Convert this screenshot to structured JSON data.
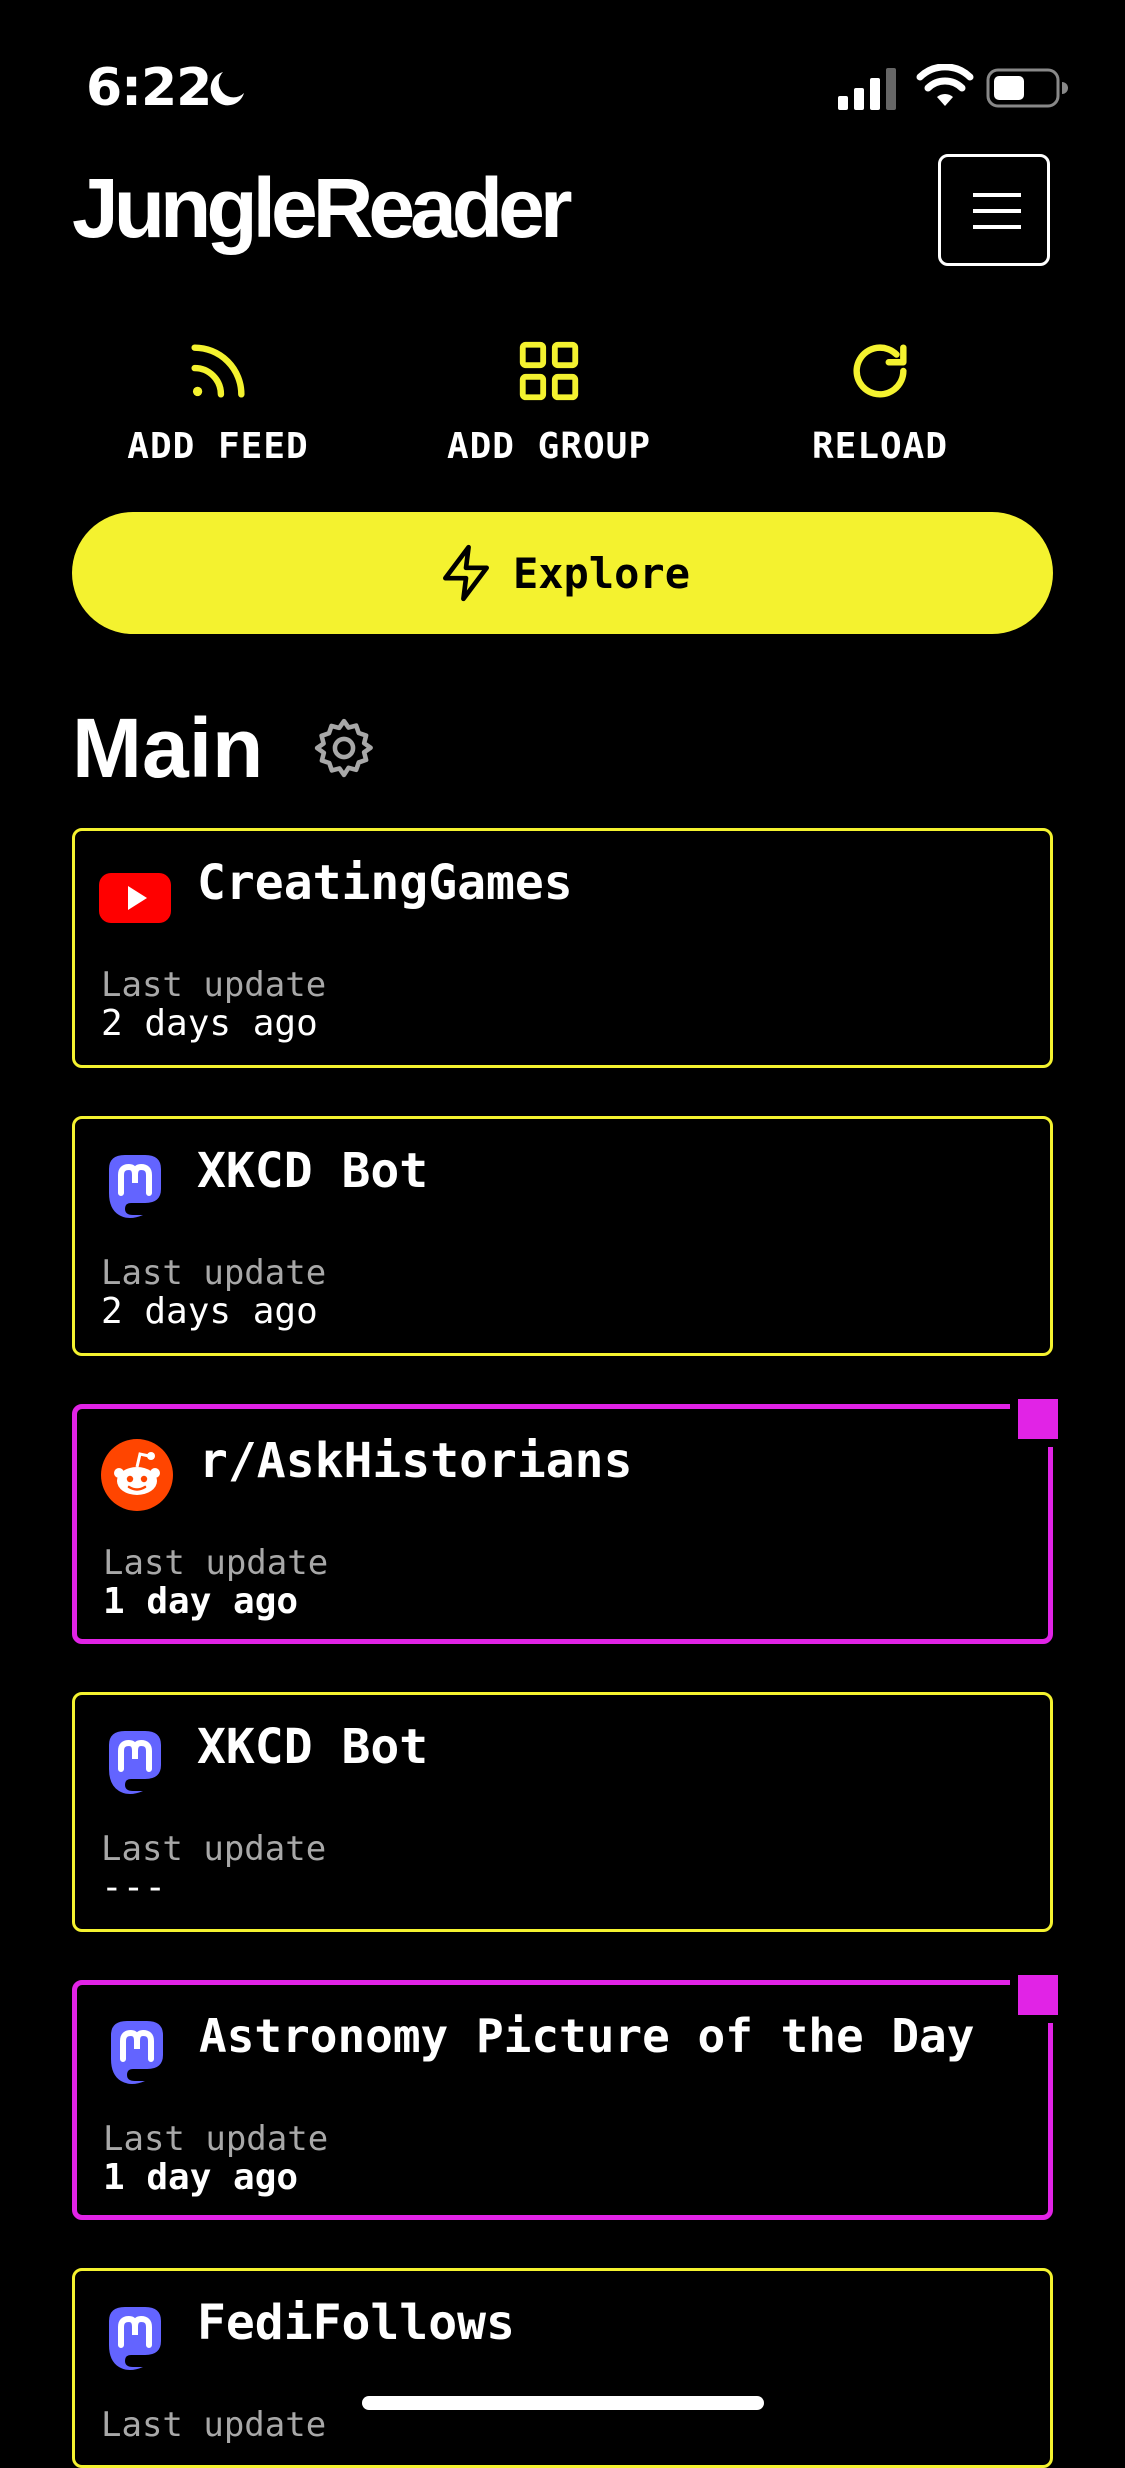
{
  "status": {
    "time": "6:22"
  },
  "header": {
    "brand": "JungleReader"
  },
  "actions": {
    "add_feed": "ADD FEED",
    "add_group": "ADD GROUP",
    "reload": "RELOAD"
  },
  "explore": {
    "label": "Explore"
  },
  "section": {
    "title": "Main"
  },
  "colors": {
    "accent": "#f4f22f",
    "unread": "#e123e6",
    "background": "#000000"
  },
  "feeds": [
    {
      "title": "CreatingGames",
      "icon": "youtube-icon",
      "meta_label": "Last update",
      "meta_value": "2 days ago",
      "unread": false
    },
    {
      "title": "XKCD Bot",
      "icon": "mastodon-icon",
      "meta_label": "Last update",
      "meta_value": "2 days ago",
      "unread": false
    },
    {
      "title": "r/AskHistorians",
      "icon": "reddit-icon",
      "meta_label": "Last update",
      "meta_value": "1 day ago",
      "unread": true
    },
    {
      "title": "XKCD Bot",
      "icon": "mastodon-icon",
      "meta_label": "Last update",
      "meta_value": "---",
      "unread": false
    },
    {
      "title": "Astronomy Picture of the Day",
      "icon": "mastodon-icon",
      "meta_label": "Last update",
      "meta_value": "1 day ago",
      "unread": true
    },
    {
      "title": "FediFollows",
      "icon": "mastodon-icon",
      "meta_label": "Last update",
      "meta_value": "",
      "unread": false
    }
  ]
}
